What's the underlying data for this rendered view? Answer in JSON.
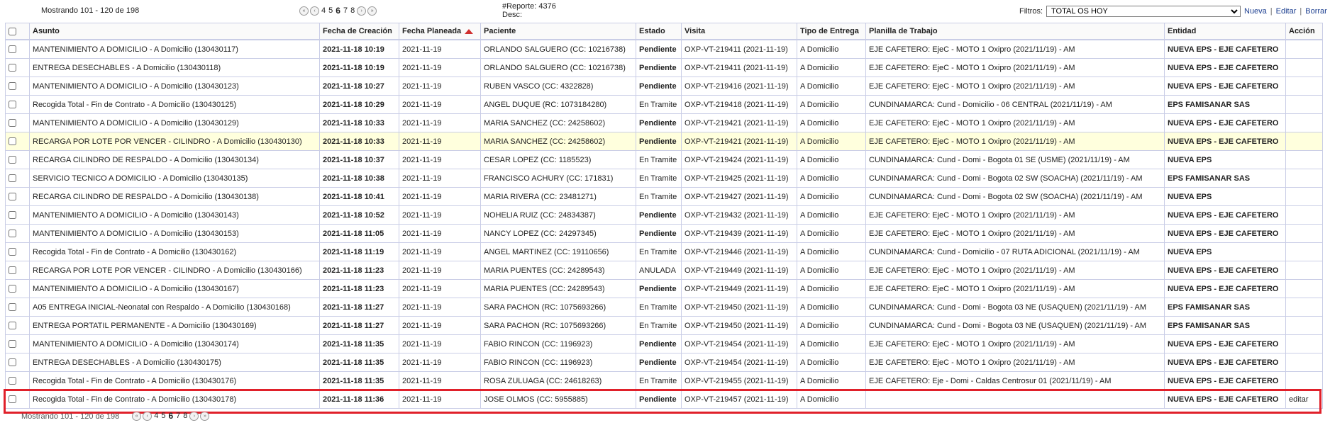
{
  "top": {
    "showing": "Mostrando 101 - 120 de 198",
    "pager": {
      "first": "«",
      "prev": "‹",
      "pages": [
        "4",
        "5",
        "6",
        "7",
        "8"
      ],
      "current": "6",
      "next": "›",
      "last": "»"
    },
    "report_line1": "#Reporte: 4376",
    "report_line2": "Desc:",
    "filters_label": "Filtros:",
    "filter_selected": "TOTAL OS HOY",
    "new_link": "Nueva",
    "edit_link": "Editar",
    "delete_link": "Borrar",
    "sep": "|"
  },
  "columns": [
    "Asunto",
    "Fecha de Creación",
    "Fecha Planeada",
    "Paciente",
    "Estado",
    "Visita",
    "Tipo de Entrega",
    "Planilla de Trabajo",
    "Entidad",
    "Acción"
  ],
  "rows": [
    {
      "asunto": "MANTENIMIENTO A DOMICILIO - A Domicilio (130430117)",
      "creacion": "2021-11-18 10:19",
      "planeada": "2021-11-19",
      "paciente": "ORLANDO SALGUERO (CC: 10216738)",
      "estado": "Pendiente",
      "visita": "OXP-VT-219411 (2021-11-19)",
      "tipo": "A Domicilio",
      "planilla": "EJE CAFETERO: EjeC - MOTO 1 Oxipro (2021/11/19) - AM",
      "entidad": "NUEVA EPS - EJE CAFETERO",
      "accion": ""
    },
    {
      "asunto": "ENTREGA DESECHABLES - A Domicilio (130430118)",
      "creacion": "2021-11-18 10:19",
      "planeada": "2021-11-19",
      "paciente": "ORLANDO SALGUERO (CC: 10216738)",
      "estado": "Pendiente",
      "visita": "OXP-VT-219411 (2021-11-19)",
      "tipo": "A Domicilio",
      "planilla": "EJE CAFETERO: EjeC - MOTO 1 Oxipro (2021/11/19) - AM",
      "entidad": "NUEVA EPS - EJE CAFETERO",
      "accion": ""
    },
    {
      "asunto": "MANTENIMIENTO A DOMICILIO - A Domicilio (130430123)",
      "creacion": "2021-11-18 10:27",
      "planeada": "2021-11-19",
      "paciente": "RUBEN VASCO (CC: 4322828)",
      "estado": "Pendiente",
      "visita": "OXP-VT-219416 (2021-11-19)",
      "tipo": "A Domicilio",
      "planilla": "EJE CAFETERO: EjeC - MOTO 1 Oxipro (2021/11/19) - AM",
      "entidad": "NUEVA EPS - EJE CAFETERO",
      "accion": ""
    },
    {
      "asunto": "Recogida Total - Fin de Contrato - A Domicilio (130430125)",
      "creacion": "2021-11-18 10:29",
      "planeada": "2021-11-19",
      "paciente": "ANGEL DUQUE (RC: 1073184280)",
      "estado": "En Tramite",
      "visita": "OXP-VT-219418 (2021-11-19)",
      "tipo": "A Domicilio",
      "planilla": "CUNDINAMARCA: Cund - Domicilio - 06 CENTRAL (2021/11/19) - AM",
      "entidad": "EPS FAMISANAR SAS",
      "accion": ""
    },
    {
      "asunto": "MANTENIMIENTO A DOMICILIO - A Domicilio (130430129)",
      "creacion": "2021-11-18 10:33",
      "planeada": "2021-11-19",
      "paciente": "MARIA SANCHEZ (CC: 24258602)",
      "estado": "Pendiente",
      "visita": "OXP-VT-219421 (2021-11-19)",
      "tipo": "A Domicilio",
      "planilla": "EJE CAFETERO: EjeC - MOTO 1 Oxipro (2021/11/19) - AM",
      "entidad": "NUEVA EPS - EJE CAFETERO",
      "accion": ""
    },
    {
      "asunto": "RECARGA POR LOTE POR VENCER - CILINDRO - A Domicilio (130430130)",
      "creacion": "2021-11-18 10:33",
      "planeada": "2021-11-19",
      "paciente": "MARIA SANCHEZ (CC: 24258602)",
      "estado": "Pendiente",
      "visita": "OXP-VT-219421 (2021-11-19)",
      "tipo": "A Domicilio",
      "planilla": "EJE CAFETERO: EjeC - MOTO 1 Oxipro (2021/11/19) - AM",
      "entidad": "NUEVA EPS - EJE CAFETERO",
      "accion": "",
      "highlight": true
    },
    {
      "asunto": "RECARGA CILINDRO DE RESPALDO - A Domicilio (130430134)",
      "creacion": "2021-11-18 10:37",
      "planeada": "2021-11-19",
      "paciente": "CESAR LOPEZ (CC: 1185523)",
      "estado": "En Tramite",
      "visita": "OXP-VT-219424 (2021-11-19)",
      "tipo": "A Domicilio",
      "planilla": "CUNDINAMARCA: Cund - Domi - Bogota 01 SE (USME) (2021/11/19) - AM",
      "entidad": "NUEVA EPS",
      "accion": ""
    },
    {
      "asunto": "SERVICIO TECNICO A DOMICILIO - A Domicilio (130430135)",
      "creacion": "2021-11-18 10:38",
      "planeada": "2021-11-19",
      "paciente": "FRANCISCO ACHURY (CC: 171831)",
      "estado": "En Tramite",
      "visita": "OXP-VT-219425 (2021-11-19)",
      "tipo": "A Domicilio",
      "planilla": "CUNDINAMARCA: Cund - Domi - Bogota 02 SW (SOACHA) (2021/11/19) - AM",
      "entidad": "EPS FAMISANAR SAS",
      "accion": ""
    },
    {
      "asunto": "RECARGA CILINDRO DE RESPALDO - A Domicilio (130430138)",
      "creacion": "2021-11-18 10:41",
      "planeada": "2021-11-19",
      "paciente": "MARIA RIVERA (CC: 23481271)",
      "estado": "En Tramite",
      "visita": "OXP-VT-219427 (2021-11-19)",
      "tipo": "A Domicilio",
      "planilla": "CUNDINAMARCA: Cund - Domi - Bogota 02 SW (SOACHA) (2021/11/19) - AM",
      "entidad": "NUEVA EPS",
      "accion": ""
    },
    {
      "asunto": "MANTENIMIENTO A DOMICILIO - A Domicilio (130430143)",
      "creacion": "2021-11-18 10:52",
      "planeada": "2021-11-19",
      "paciente": "NOHELIA RUIZ (CC: 24834387)",
      "estado": "Pendiente",
      "visita": "OXP-VT-219432 (2021-11-19)",
      "tipo": "A Domicilio",
      "planilla": "EJE CAFETERO: EjeC - MOTO 1 Oxipro (2021/11/19) - AM",
      "entidad": "NUEVA EPS - EJE CAFETERO",
      "accion": ""
    },
    {
      "asunto": "MANTENIMIENTO A DOMICILIO - A Domicilio (130430153)",
      "creacion": "2021-11-18 11:05",
      "planeada": "2021-11-19",
      "paciente": "NANCY LOPEZ (CC: 24297345)",
      "estado": "Pendiente",
      "visita": "OXP-VT-219439 (2021-11-19)",
      "tipo": "A Domicilio",
      "planilla": "EJE CAFETERO: EjeC - MOTO 1 Oxipro (2021/11/19) - AM",
      "entidad": "NUEVA EPS - EJE CAFETERO",
      "accion": ""
    },
    {
      "asunto": "Recogida Total - Fin de Contrato - A Domicilio (130430162)",
      "creacion": "2021-11-18 11:19",
      "planeada": "2021-11-19",
      "paciente": "ANGEL MARTINEZ (CC: 19110656)",
      "estado": "En Tramite",
      "visita": "OXP-VT-219446 (2021-11-19)",
      "tipo": "A Domicilio",
      "planilla": "CUNDINAMARCA: Cund - Domicilio - 07 RUTA ADICIONAL (2021/11/19) - AM",
      "entidad": "NUEVA EPS",
      "accion": ""
    },
    {
      "asunto": "RECARGA POR LOTE POR VENCER - CILINDRO - A Domicilio (130430166)",
      "creacion": "2021-11-18 11:23",
      "planeada": "2021-11-19",
      "paciente": "MARIA PUENTES (CC: 24289543)",
      "estado": "ANULADA",
      "visita": "OXP-VT-219449 (2021-11-19)",
      "tipo": "A Domicilio",
      "planilla": "EJE CAFETERO: EjeC - MOTO 1 Oxipro (2021/11/19) - AM",
      "entidad": "NUEVA EPS - EJE CAFETERO",
      "accion": ""
    },
    {
      "asunto": "MANTENIMIENTO A DOMICILIO - A Domicilio (130430167)",
      "creacion": "2021-11-18 11:23",
      "planeada": "2021-11-19",
      "paciente": "MARIA PUENTES (CC: 24289543)",
      "estado": "Pendiente",
      "visita": "OXP-VT-219449 (2021-11-19)",
      "tipo": "A Domicilio",
      "planilla": "EJE CAFETERO: EjeC - MOTO 1 Oxipro (2021/11/19) - AM",
      "entidad": "NUEVA EPS - EJE CAFETERO",
      "accion": ""
    },
    {
      "asunto": "A05 ENTREGA INICIAL-Neonatal con Respaldo - A Domicilio (130430168)",
      "creacion": "2021-11-18 11:27",
      "planeada": "2021-11-19",
      "paciente": "SARA PACHON (RC: 1075693266)",
      "estado": "En Tramite",
      "visita": "OXP-VT-219450 (2021-11-19)",
      "tipo": "A Domicilio",
      "planilla": "CUNDINAMARCA: Cund - Domi - Bogota 03 NE (USAQUEN) (2021/11/19) - AM",
      "entidad": "EPS FAMISANAR SAS",
      "accion": ""
    },
    {
      "asunto": "ENTREGA PORTATIL PERMANENTE - A Domicilio (130430169)",
      "creacion": "2021-11-18 11:27",
      "planeada": "2021-11-19",
      "paciente": "SARA PACHON (RC: 1075693266)",
      "estado": "En Tramite",
      "visita": "OXP-VT-219450 (2021-11-19)",
      "tipo": "A Domicilio",
      "planilla": "CUNDINAMARCA: Cund - Domi - Bogota 03 NE (USAQUEN) (2021/11/19) - AM",
      "entidad": "EPS FAMISANAR SAS",
      "accion": ""
    },
    {
      "asunto": "MANTENIMIENTO A DOMICILIO - A Domicilio (130430174)",
      "creacion": "2021-11-18 11:35",
      "planeada": "2021-11-19",
      "paciente": "FABIO RINCON (CC: 1196923)",
      "estado": "Pendiente",
      "visita": "OXP-VT-219454 (2021-11-19)",
      "tipo": "A Domicilio",
      "planilla": "EJE CAFETERO: EjeC - MOTO 1 Oxipro (2021/11/19) - AM",
      "entidad": "NUEVA EPS - EJE CAFETERO",
      "accion": ""
    },
    {
      "asunto": "ENTREGA DESECHABLES - A Domicilio (130430175)",
      "creacion": "2021-11-18 11:35",
      "planeada": "2021-11-19",
      "paciente": "FABIO RINCON (CC: 1196923)",
      "estado": "Pendiente",
      "visita": "OXP-VT-219454 (2021-11-19)",
      "tipo": "A Domicilio",
      "planilla": "EJE CAFETERO: EjeC - MOTO 1 Oxipro (2021/11/19) - AM",
      "entidad": "NUEVA EPS - EJE CAFETERO",
      "accion": ""
    },
    {
      "asunto": "Recogida Total - Fin de Contrato - A Domicilio (130430176)",
      "creacion": "2021-11-18 11:35",
      "planeada": "2021-11-19",
      "paciente": "ROSA ZULUAGA (CC: 24618263)",
      "estado": "En Tramite",
      "visita": "OXP-VT-219455 (2021-11-19)",
      "tipo": "A Domicilio",
      "planilla": "EJE CAFETERO: Eje - Domi - Caldas Centrosur 01 (2021/11/19) - AM",
      "entidad": "NUEVA EPS - EJE CAFETERO",
      "accion": ""
    },
    {
      "asunto": "Recogida Total - Fin de Contrato - A Domicilio (130430178)",
      "creacion": "2021-11-18 11:36",
      "planeada": "2021-11-19",
      "paciente": "JOSE OLMOS (CC: 5955885)",
      "estado": "Pendiente",
      "visita": "OXP-VT-219457 (2021-11-19)",
      "tipo": "A Domicilio",
      "planilla": "",
      "entidad": "NUEVA EPS - EJE CAFETERO",
      "accion": "editar"
    }
  ],
  "bottom": {
    "showing": "Mostrando 101 - 120 de 198"
  },
  "colors": {
    "highlight_row": "#ffffdd",
    "selection_box": "#e0202a",
    "sort_arrow": "#d03030",
    "border": "#c9cde6"
  }
}
